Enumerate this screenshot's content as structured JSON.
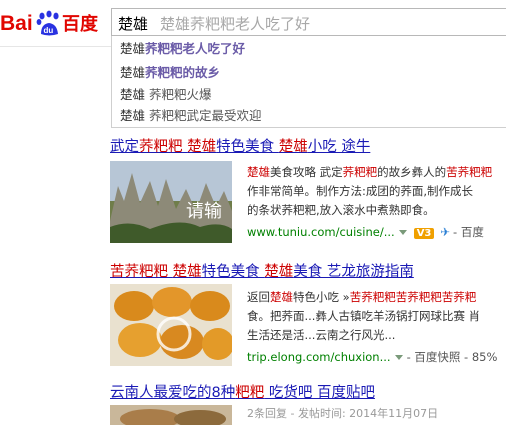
{
  "header": {
    "logo_text_1": "Bai",
    "logo_text_2": "du",
    "logo_text_3": "百度",
    "search_typed": "楚雄",
    "search_ghost": "楚雄荞粑粑老人吃了好"
  },
  "suggestions": [
    {
      "prefix": "楚雄",
      "rest": "荞粑粑老人吃了好",
      "style": "bold"
    },
    {
      "prefix": "楚雄",
      "rest": "荞粑粑的故乡",
      "style": "bold"
    },
    {
      "prefix": "楚雄",
      "rest": " 荞粑粑火爆",
      "style": "plain"
    },
    {
      "prefix": "楚雄",
      "rest": " 荞粑粑武定最受欢迎",
      "style": "plain"
    }
  ],
  "results": [
    {
      "title_parts": [
        "武定",
        "荞粑粑",
        " ",
        "楚雄",
        "特色美食 ",
        "楚雄",
        "小吃 途牛"
      ],
      "thumb_label": "请输",
      "snippet_lines": [
        [
          "楚雄",
          "美食攻略 武定",
          "荞粑粑",
          "的故乡彝人的",
          "苦荞粑粑"
        ],
        [
          "作非常简单。制作方法:成团的荞面,制作成长"
        ],
        [
          "的条状荞粑粑,放入滚水中煮熟即食。"
        ]
      ],
      "url": "www.tuniu.com/cuisine/...",
      "v3": "V3",
      "snapshot": "- 百度"
    },
    {
      "title_parts": [
        "苦荞粑粑",
        " ",
        "楚雄",
        "特色美食 ",
        "楚雄",
        "美食 艺龙旅游指南"
      ],
      "snippet_lines": [
        [
          "返回",
          "楚雄",
          "特色小吃 »",
          "苦荞粑粑苦荞粑粑苦荞粑"
        ],
        [
          "食。把荞面...彝人古镇吃羊汤锅打网球比赛 肖"
        ],
        [
          "生活还是活...云南之行风光..."
        ]
      ],
      "url": "trip.elong.com/chuxion...",
      "snapshot": "- 百度快照 - 85%"
    },
    {
      "title_parts": [
        "云南人最爱吃的8种",
        "粑粑",
        " 吃货吧 百度贴吧"
      ],
      "meta": "2条回复 - 发帖时间: 2014年11月07日"
    }
  ]
}
